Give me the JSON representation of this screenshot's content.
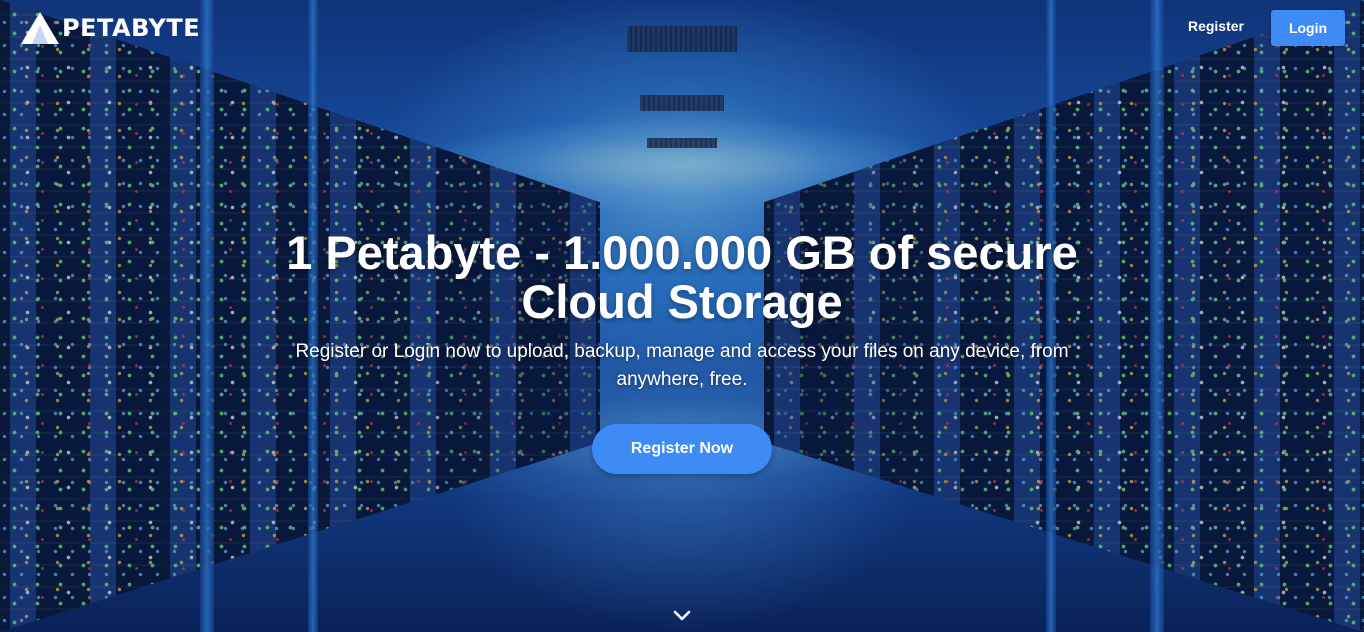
{
  "brand": {
    "name": "PETABYTE",
    "logo_icon": "triangle-logo-icon"
  },
  "nav": {
    "register_label": "Register",
    "login_label": "Login"
  },
  "hero": {
    "title": "1 Petabyte - 1.000.000 GB of secure Cloud Storage",
    "subtitle": "Register or Login now to upload, backup, manage and access your files on any device, from anywhere, free.",
    "cta_label": "Register Now",
    "scroll_icon": "chevron-down-icon",
    "background_image": "server-room-corridor"
  },
  "colors": {
    "accent": "#3f8bf5",
    "text": "#ffffff"
  }
}
